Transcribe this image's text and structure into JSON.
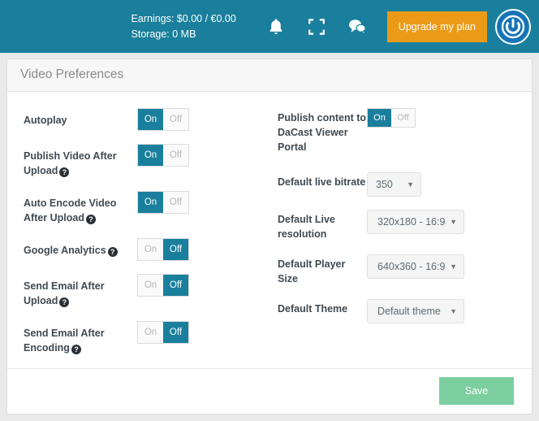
{
  "topbar": {
    "earnings": "Earnings: $0.00 / €0.00",
    "storage": "Storage: 0 MB",
    "icons": [
      "bell-icon",
      "fullscreen-icon",
      "chat-icon"
    ],
    "upgrade_label": "Upgrade my plan",
    "logo_name": "power-logo",
    "bg_color": "#1a7f9c",
    "upgrade_color": "#eb9a17"
  },
  "panel": {
    "title": "Video Preferences",
    "save_label": "Save",
    "save_color": "#7bcf9e"
  },
  "left_column": [
    {
      "label": "Autoplay",
      "help": false,
      "on_label": "On",
      "off_label": "Off",
      "state": "On"
    },
    {
      "label": "Publish Video After Upload",
      "help": true,
      "on_label": "On",
      "off_label": "Off",
      "state": "On"
    },
    {
      "label": "Auto Encode Video After Upload",
      "help": true,
      "on_label": "On",
      "off_label": "Off",
      "state": "On"
    },
    {
      "label": "Google Analytics",
      "help": true,
      "on_label": "On",
      "off_label": "Off",
      "state": "Off"
    },
    {
      "label": "Send Email After Upload",
      "help": true,
      "on_label": "On",
      "off_label": "Off",
      "state": "Off"
    },
    {
      "label": "Send Email After Encoding",
      "help": true,
      "on_label": "On",
      "off_label": "Off",
      "state": "Off"
    }
  ],
  "right_column": {
    "publish_portal": {
      "label": "Publish content to DaCast Viewer Portal",
      "on_label": "On",
      "off_label": "Off",
      "state": "On"
    },
    "live_bitrate": {
      "label": "Default live bitrate",
      "value": "350"
    },
    "live_resolution": {
      "label": "Default Live resolution",
      "value": "320x180 - 16:9"
    },
    "player_size": {
      "label": "Default Player Size",
      "value": "640x360 - 16:9"
    },
    "theme": {
      "label": "Default Theme",
      "value": "Default theme"
    }
  },
  "glyphs": {
    "help": "?",
    "caret": "▼"
  }
}
